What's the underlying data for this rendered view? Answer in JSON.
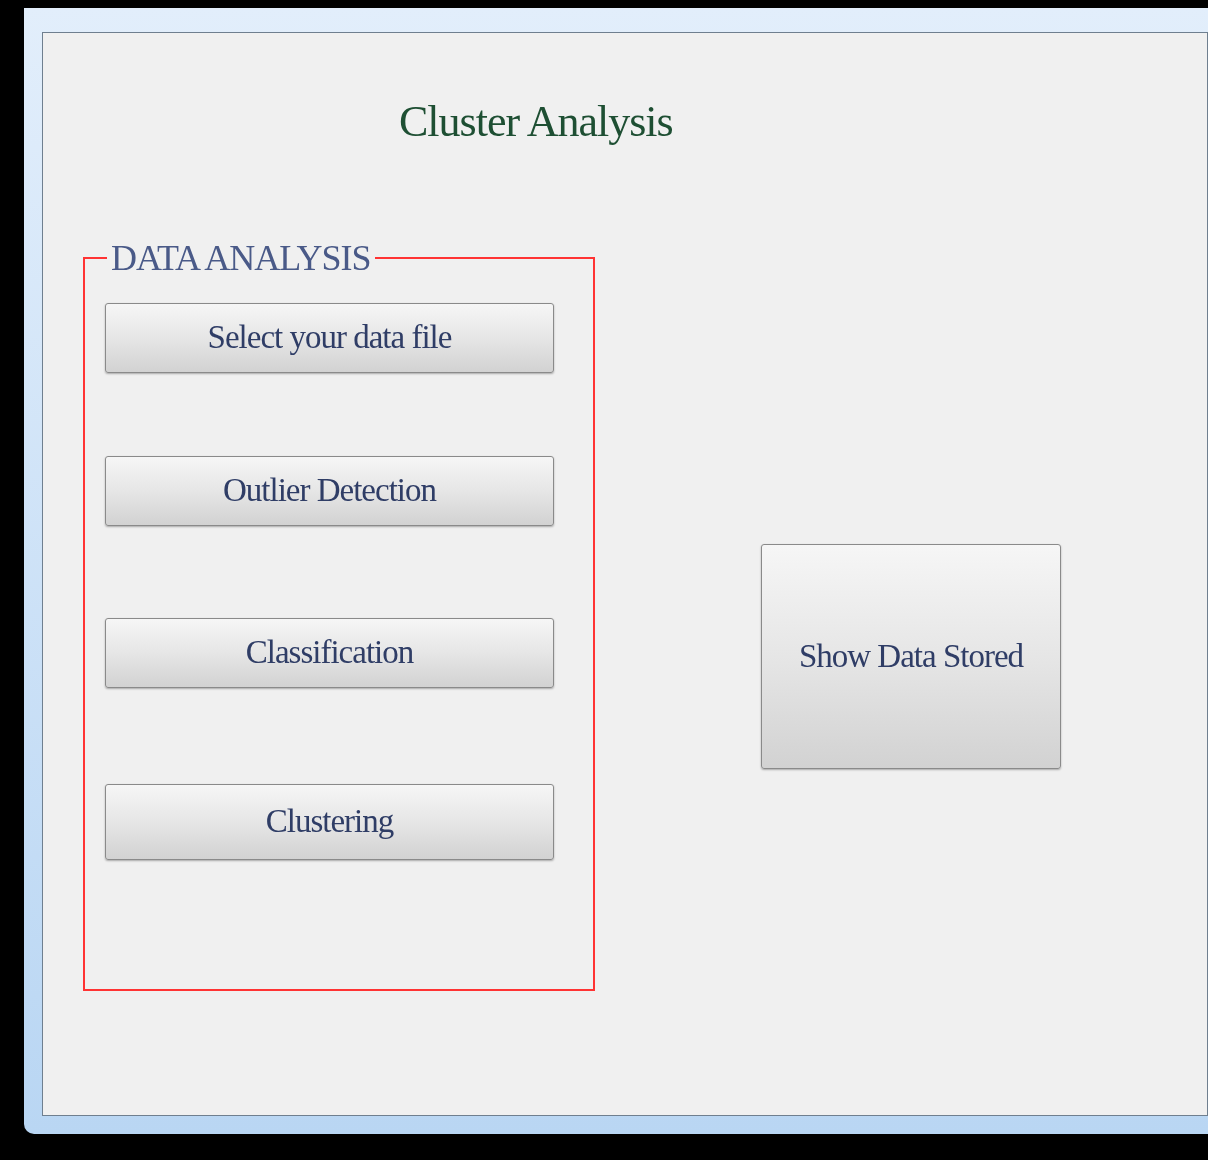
{
  "title": "Cluster Analysis",
  "group": {
    "legend": "DATA ANALYSIS",
    "buttons": [
      "Select your data file",
      "Outlier Detection",
      "Classification",
      "Clustering"
    ]
  },
  "side_button": "Show Data Stored"
}
